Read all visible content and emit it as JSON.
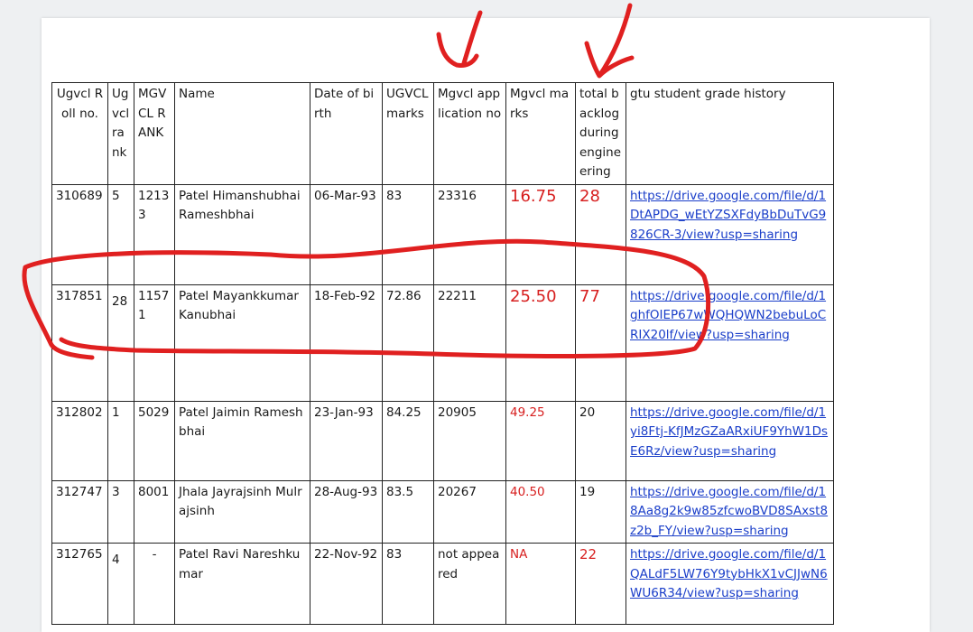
{
  "headers": {
    "roll": "Ugvcl Roll no.",
    "ugvcl_rank": "Ugvcl rank",
    "mgvcl_rank": "MGVCL RANK",
    "name": "Name",
    "dob": "Date of birth",
    "ugvcl_marks": "UGVCL marks",
    "mgvcl_app": "Mgvcl application no",
    "mgvcl_marks": "Mgvcl marks",
    "backlog": "total backlog during engineering",
    "history": "gtu student grade history"
  },
  "rows": [
    {
      "roll": "310689",
      "ugvcl_rank": "5",
      "mgvcl_rank": "12133",
      "name": "Patel Himanshubhai Rameshbhai",
      "dob": "06-Mar-93",
      "ugvcl_marks": "83",
      "mgvcl_app": "23316",
      "mgvcl_marks": "16.75",
      "backlog": "28",
      "link": "https://drive.google.com/file/d/1DtAPDG_wEtYZSXFdyBbDuTvG9826CR-3/view?usp=sharing"
    },
    {
      "roll": "317851",
      "ugvcl_rank": "28",
      "mgvcl_rank": "11571",
      "name": "Patel Mayankkumar Kanubhai",
      "dob": "18-Feb-92",
      "ugvcl_marks": "72.86",
      "mgvcl_app": "22211",
      "mgvcl_marks": "25.50",
      "backlog": "77",
      "link": "https://drive.google.com/file/d/1ghfOIEP67wWQHQWN2bebuLoCRIX20lf/view?usp=sharing"
    },
    {
      "roll": "312802",
      "ugvcl_rank": "1",
      "mgvcl_rank": "5029",
      "name": "Patel Jaimin Rameshbhai",
      "dob": "23-Jan-93",
      "ugvcl_marks": "84.25",
      "mgvcl_app": "20905",
      "mgvcl_marks": "49.25",
      "backlog": "20",
      "link": "https://drive.google.com/file/d/1yi8Ftj-KfJMzGZaARxiUF9YhW1DsE6Rz/view?usp=sharing"
    },
    {
      "roll": "312747",
      "ugvcl_rank": "3",
      "mgvcl_rank": "8001",
      "name": "Jhala Jayrajsinh Mulrajsinh",
      "dob": "28-Aug-93",
      "ugvcl_marks": "83.5",
      "mgvcl_app": "20267",
      "mgvcl_marks": "40.50",
      "backlog": "19",
      "link": "https://drive.google.com/file/d/18Aa8g2k9w85zfcwoBVD8SAxst8z2b_FY/view?usp=sharing"
    },
    {
      "roll": "312765",
      "ugvcl_rank": "4",
      "mgvcl_rank": "-",
      "name": "Patel Ravi Nareshkumar",
      "dob": "22-Nov-92",
      "ugvcl_marks": "83",
      "mgvcl_app": "not appeared",
      "mgvcl_marks": "NA",
      "backlog": "22",
      "link": "https://drive.google.com/file/d/1QALdF5LW76Y9tybHkX1vCJJwN6WU6R34/view?usp=sharing"
    }
  ],
  "annotation_color": "#e02020"
}
